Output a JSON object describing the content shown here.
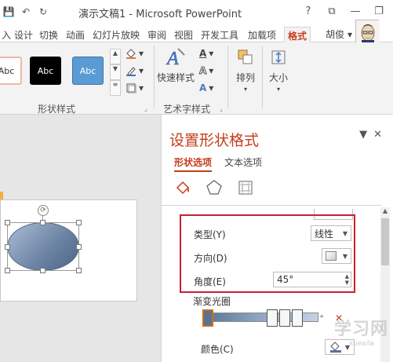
{
  "window": {
    "title": "演示文稿1 - Microsoft PowerPoint",
    "controls": [
      "?",
      "⧉",
      "—",
      "❐"
    ]
  },
  "qat": {
    "items": [
      "💾",
      "↶",
      "↻"
    ]
  },
  "tabs": [
    "入",
    "设计",
    "切换",
    "动画",
    "幻灯片放映",
    "审阅",
    "视图",
    "开发工具",
    "加载项",
    "格式"
  ],
  "active_tab": "格式",
  "user": {
    "name": "胡俊",
    "arrow": "▾"
  },
  "ribbon": {
    "style_swatches": [
      "Abc",
      "Abc",
      "Abc"
    ],
    "shape_styles_label": "形状样式",
    "quick_styles_label": "快速样式",
    "art_text_label": "艺术字样式",
    "arrange_label": "排列",
    "size_label": "大小"
  },
  "pane": {
    "title": "设置形状格式",
    "tabs": [
      "形状选项",
      "文本选项"
    ],
    "active_tab": "形状选项",
    "type_label": "类型(Y)",
    "type_value": "线性",
    "direction_label": "方向(D)",
    "angle_label": "角度(E)",
    "angle_value": "45°",
    "gradient_stops_label": "渐变光圈",
    "color_label": "颜色(C)"
  },
  "watermark": {
    "main": "学习网",
    "sub": "xuexila"
  },
  "colors": {
    "accent": "#c43e1c",
    "highlight_border": "#cc1f2f",
    "shape_gradient_start": "#a9bdd6",
    "shape_gradient_end": "#4d6585"
  },
  "gradient": {
    "angle_degrees": 45,
    "type": "linear"
  }
}
